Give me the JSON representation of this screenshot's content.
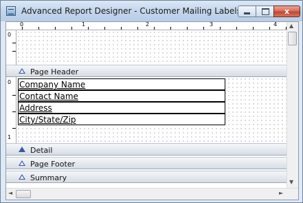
{
  "window": {
    "title": "Advanced Report Designer - Customer Mailing Labels",
    "close_glyph": "x"
  },
  "ruler": {
    "numbers": [
      "0",
      "1",
      "2",
      "3",
      "4"
    ],
    "side_numbers": [
      "0",
      "0",
      "1"
    ]
  },
  "bands": [
    {
      "label": "Page Header",
      "expanded": false
    },
    {
      "label": "Detail",
      "expanded": true
    },
    {
      "label": "Page Footer",
      "expanded": false
    },
    {
      "label": "Summary",
      "expanded": false
    }
  ],
  "detail_fields": [
    "Company Name",
    "Contact Name",
    "Address",
    "City/State/Zip"
  ],
  "scroll": {
    "up": "▲",
    "down": "▼",
    "left": "◄",
    "right": "►"
  },
  "colors": {
    "band_arrow": "#3b57a2",
    "close_button": "#c34630"
  }
}
